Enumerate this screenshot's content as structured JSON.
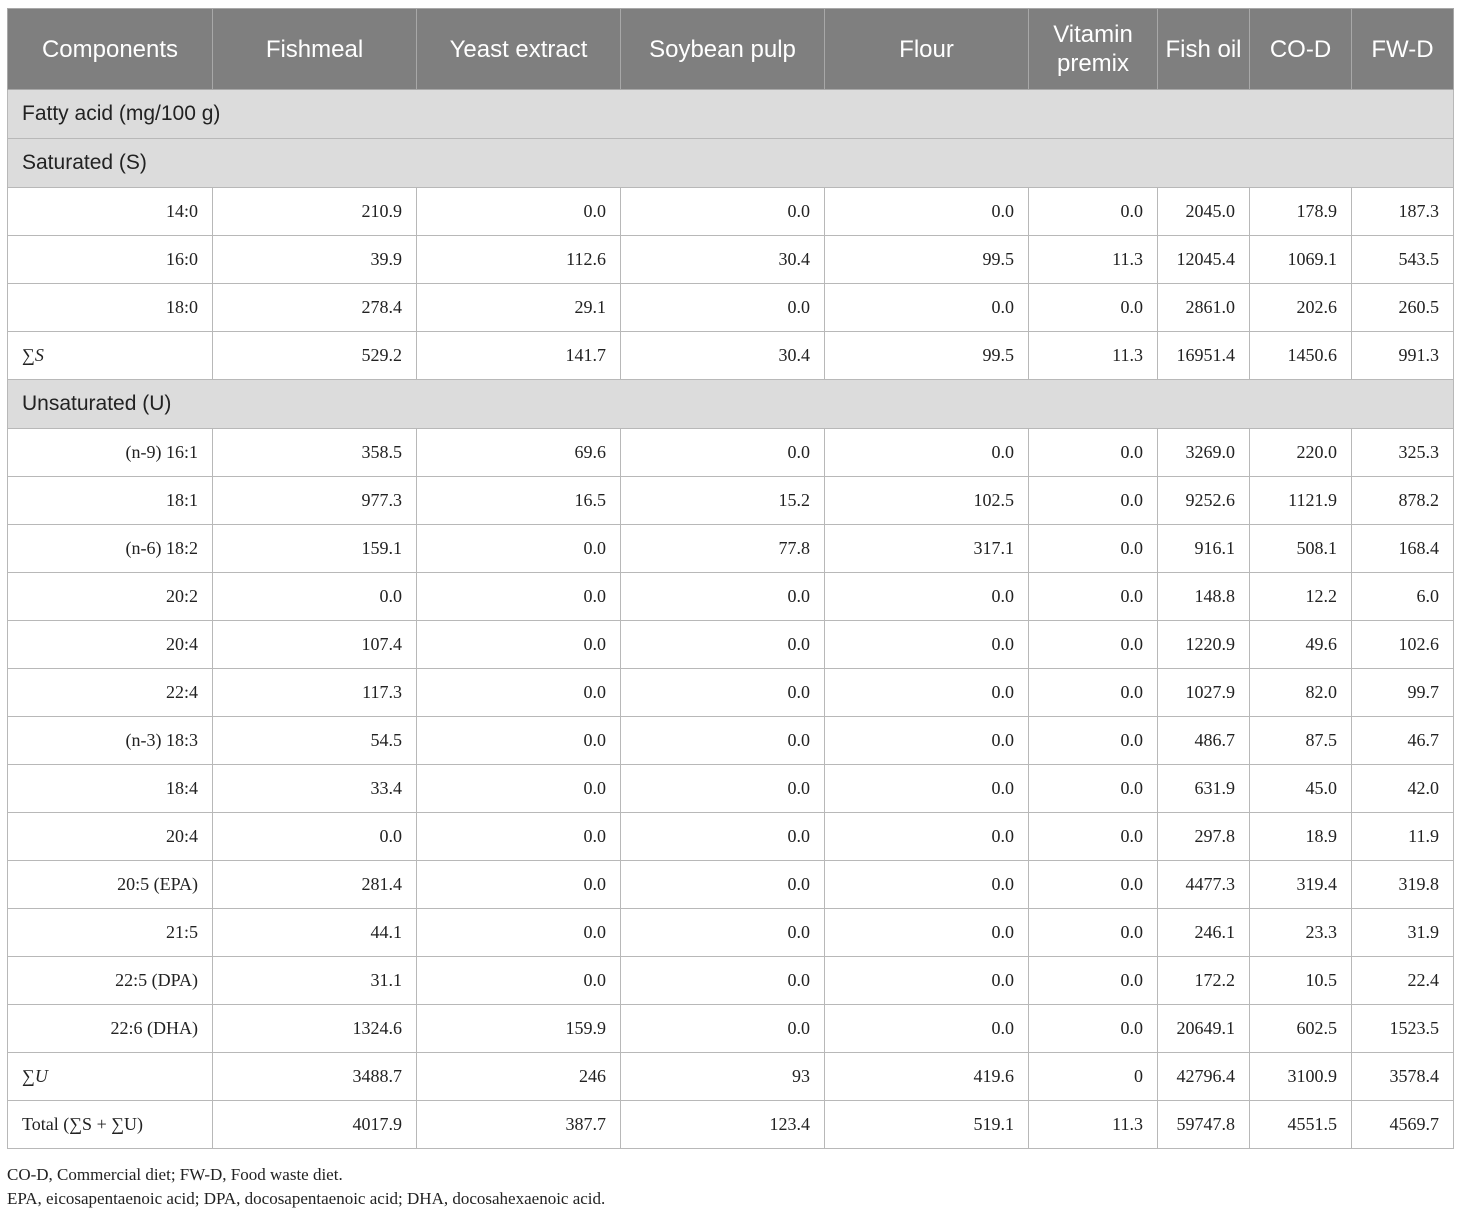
{
  "header": [
    "Components",
    "Fishmeal",
    "Yeast extract",
    "Soybean pulp",
    "Flour",
    "Vitamin premix",
    "Fish oil",
    "CO-D",
    "FW-D"
  ],
  "section_main": "Fatty acid (mg/100 g)",
  "section_saturated": "Saturated (S)",
  "saturated_rows": [
    [
      "14:0",
      "210.9",
      "0.0",
      "0.0",
      "0.0",
      "0.0",
      "2045.0",
      "178.9",
      "187.3"
    ],
    [
      "16:0",
      "39.9",
      "112.6",
      "30.4",
      "99.5",
      "11.3",
      "12045.4",
      "1069.1",
      "543.5"
    ],
    [
      "18:0",
      "278.4",
      "29.1",
      "0.0",
      "0.0",
      "0.0",
      "2861.0",
      "202.6",
      "260.5"
    ]
  ],
  "sum_s": {
    "label": "∑S",
    "values": [
      "529.2",
      "141.7",
      "30.4",
      "99.5",
      "11.3",
      "16951.4",
      "1450.6",
      "991.3"
    ]
  },
  "section_unsaturated": "Unsaturated (U)",
  "unsaturated_rows": [
    [
      "(n-9) 16:1",
      "358.5",
      "69.6",
      "0.0",
      "0.0",
      "0.0",
      "3269.0",
      "220.0",
      "325.3"
    ],
    [
      "18:1",
      "977.3",
      "16.5",
      "15.2",
      "102.5",
      "0.0",
      "9252.6",
      "1121.9",
      "878.2"
    ],
    [
      "(n-6) 18:2",
      "159.1",
      "0.0",
      "77.8",
      "317.1",
      "0.0",
      "916.1",
      "508.1",
      "168.4"
    ],
    [
      "20:2",
      "0.0",
      "0.0",
      "0.0",
      "0.0",
      "0.0",
      "148.8",
      "12.2",
      "6.0"
    ],
    [
      "20:4",
      "107.4",
      "0.0",
      "0.0",
      "0.0",
      "0.0",
      "1220.9",
      "49.6",
      "102.6"
    ],
    [
      "22:4",
      "117.3",
      "0.0",
      "0.0",
      "0.0",
      "0.0",
      "1027.9",
      "82.0",
      "99.7"
    ],
    [
      "(n-3) 18:3",
      "54.5",
      "0.0",
      "0.0",
      "0.0",
      "0.0",
      "486.7",
      "87.5",
      "46.7"
    ],
    [
      "18:4",
      "33.4",
      "0.0",
      "0.0",
      "0.0",
      "0.0",
      "631.9",
      "45.0",
      "42.0"
    ],
    [
      "20:4",
      "0.0",
      "0.0",
      "0.0",
      "0.0",
      "0.0",
      "297.8",
      "18.9",
      "11.9"
    ],
    [
      "20:5 (EPA)",
      "281.4",
      "0.0",
      "0.0",
      "0.0",
      "0.0",
      "4477.3",
      "319.4",
      "319.8"
    ],
    [
      "21:5",
      "44.1",
      "0.0",
      "0.0",
      "0.0",
      "0.0",
      "246.1",
      "23.3",
      "31.9"
    ],
    [
      "22:5 (DPA)",
      "31.1",
      "0.0",
      "0.0",
      "0.0",
      "0.0",
      "172.2",
      "10.5",
      "22.4"
    ],
    [
      "22:6 (DHA)",
      "1324.6",
      "159.9",
      "0.0",
      "0.0",
      "0.0",
      "20649.1",
      "602.5",
      "1523.5"
    ]
  ],
  "sum_u": {
    "label": "∑U",
    "values": [
      "3488.7",
      "246",
      "93",
      "419.6",
      "0",
      "42796.4",
      "3100.9",
      "3578.4"
    ]
  },
  "total": {
    "label": "Total (∑S + ∑U)",
    "values": [
      "4017.9",
      "387.7",
      "123.4",
      "519.1",
      "11.3",
      "59747.8",
      "4551.5",
      "4569.7"
    ]
  },
  "footnotes": [
    "CO-D, Commercial diet; FW-D, Food waste diet.",
    "EPA, eicosapentaenoic acid; DPA, docosapentaenoic acid; DHA, docosahexaenoic acid."
  ]
}
